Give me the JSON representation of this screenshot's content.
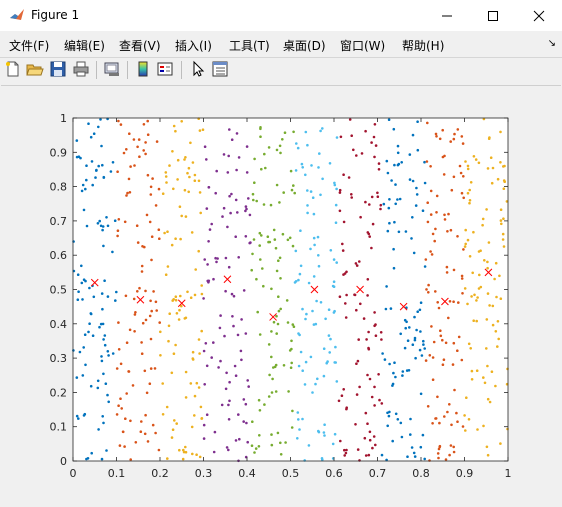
{
  "window": {
    "title": "Figure 1",
    "controls": {
      "minimize": "—",
      "maximize": "☐",
      "close": "✕"
    }
  },
  "menu": {
    "items": [
      "文件(F)",
      "编辑(E)",
      "查看(V)",
      "插入(I)",
      "工具(T)",
      "桌面(D)",
      "窗口(W)",
      "帮助(H)"
    ],
    "overflow_arrow": "↘"
  },
  "toolbar": {
    "icons": [
      "new-figure-icon",
      "open-file-icon",
      "save-icon",
      "print-icon",
      "link-plot-icon",
      "colorbar-icon",
      "legend-icon",
      "pointer-icon",
      "property-inspector-icon"
    ]
  },
  "colors": {
    "blue": "#0072BD",
    "orange": "#D95319",
    "yellow": "#EDB120",
    "purple": "#7E2F8E",
    "green": "#77AC30",
    "cyan": "#4DBEEE",
    "darkred": "#A2142F",
    "marker": "#FF0000"
  },
  "chart_data": {
    "type": "scatter",
    "title": "",
    "xlabel": "",
    "ylabel": "",
    "xlim": [
      0,
      1
    ],
    "ylim": [
      0,
      1
    ],
    "grid": false,
    "x_ticks": [
      "0",
      "0.1",
      "0.2",
      "0.3",
      "0.4",
      "0.5",
      "0.6",
      "0.7",
      "0.8",
      "0.9",
      "1"
    ],
    "y_ticks": [
      "0",
      "0.1",
      "0.2",
      "0.3",
      "0.4",
      "0.5",
      "0.6",
      "0.7",
      "0.8",
      "0.9",
      "1"
    ],
    "num_points": 1000,
    "clusters": [
      {
        "color": "#0072BD",
        "centroid": [
          0.05,
          0.52
        ],
        "x_range": [
          0.0,
          0.1
        ]
      },
      {
        "color": "#D95319",
        "centroid": [
          0.155,
          0.47
        ],
        "x_range": [
          0.1,
          0.2
        ]
      },
      {
        "color": "#EDB120",
        "centroid": [
          0.25,
          0.46
        ],
        "x_range": [
          0.2,
          0.3
        ]
      },
      {
        "color": "#7E2F8E",
        "centroid": [
          0.355,
          0.53
        ],
        "x_range": [
          0.3,
          0.41
        ]
      },
      {
        "color": "#77AC30",
        "centroid": [
          0.46,
          0.42
        ],
        "x_range": [
          0.41,
          0.51
        ]
      },
      {
        "color": "#4DBEEE",
        "centroid": [
          0.555,
          0.5
        ],
        "x_range": [
          0.51,
          0.61
        ]
      },
      {
        "color": "#A2142F",
        "centroid": [
          0.66,
          0.5
        ],
        "x_range": [
          0.61,
          0.71
        ]
      },
      {
        "color": "#0072BD",
        "centroid": [
          0.76,
          0.45
        ],
        "x_range": [
          0.71,
          0.81
        ]
      },
      {
        "color": "#D95319",
        "centroid": [
          0.855,
          0.465
        ],
        "x_range": [
          0.81,
          0.9
        ]
      },
      {
        "color": "#EDB120",
        "centroid": [
          0.955,
          0.55
        ],
        "x_range": [
          0.9,
          1.0
        ]
      }
    ]
  }
}
